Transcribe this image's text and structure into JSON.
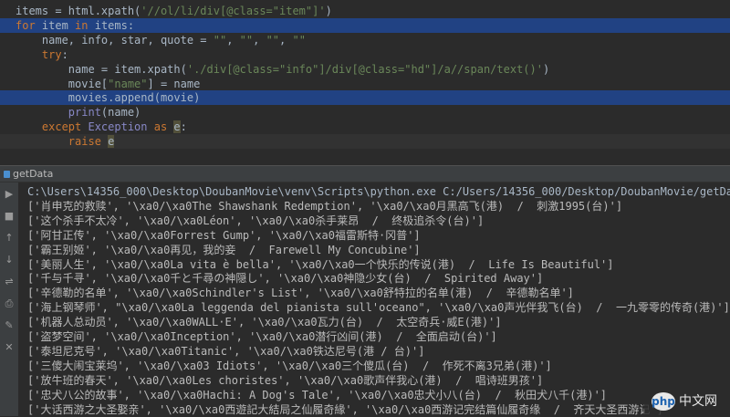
{
  "editor": {
    "lines": [
      {
        "parts": [
          [
            "items = html.xpath(",
            ""
          ],
          [
            "'//ol/li/div[@class=\"item\"]'",
            "str"
          ],
          [
            ")",
            ""
          ]
        ],
        "highlight": false
      },
      {
        "parts": [
          [
            "for ",
            "kw"
          ],
          [
            "item ",
            ""
          ],
          [
            "in ",
            "kw"
          ],
          [
            "items:",
            ""
          ]
        ],
        "highlight": true
      },
      {
        "parts": [
          [
            "    name, info, star, quote = ",
            ""
          ],
          [
            "\"\"",
            "str"
          ],
          [
            ", ",
            ""
          ],
          [
            "\"\"",
            "str"
          ],
          [
            ", ",
            ""
          ],
          [
            "\"\"",
            "str"
          ],
          [
            ", ",
            ""
          ],
          [
            "\"\"",
            "str"
          ]
        ],
        "highlight": false
      },
      {
        "parts": [
          [
            "    ",
            ""
          ],
          [
            "try",
            "kw"
          ],
          [
            ":",
            ""
          ]
        ],
        "highlight": false
      },
      {
        "parts": [
          [
            "        name = item.xpath(",
            ""
          ],
          [
            "'./div[@class=\"info\"]/div[@class=\"hd\"]/a//span/text()'",
            "str"
          ],
          [
            ")",
            ""
          ]
        ],
        "highlight": false
      },
      {
        "parts": [
          [
            "        movie[",
            ""
          ],
          [
            "\"name\"",
            "str"
          ],
          [
            "] = name",
            ""
          ]
        ],
        "highlight": false
      },
      {
        "parts": [
          [
            "        movies.append(movie)",
            ""
          ]
        ],
        "highlight": true
      },
      {
        "parts": [
          [
            "        ",
            ""
          ],
          [
            "print",
            "fn"
          ],
          [
            "(name)",
            ""
          ]
        ],
        "highlight": false
      },
      {
        "parts": [
          [
            "    ",
            ""
          ],
          [
            "except ",
            "kw"
          ],
          [
            "Exception ",
            "cls"
          ],
          [
            "as ",
            "kw"
          ],
          [
            "e",
            "sel"
          ],
          [
            ":",
            ""
          ]
        ],
        "highlight": false
      },
      {
        "parts": [
          [
            "        ",
            ""
          ],
          [
            "raise ",
            "kw"
          ],
          [
            "e",
            "sel"
          ]
        ],
        "highlight": false,
        "caret": true
      }
    ]
  },
  "run_panel": {
    "tab_label": "getData",
    "settings_icon": "gear-icon",
    "hide_icon": "minimize-icon"
  },
  "console": {
    "lines": [
      "C:\\Users\\14356_000\\Desktop\\DoubanMovie\\venv\\Scripts\\python.exe C:/Users/14356_000/Desktop/DoubanMovie/getData.py",
      "['肖申克的救赎', '\\xa0/\\xa0The Shawshank Redemption', '\\xa0/\\xa0月黑高飞(港)  /  刺激1995(台)']",
      "['这个杀手不太冷', '\\xa0/\\xa0Léon', '\\xa0/\\xa0杀手莱昂  /  终极追杀令(台)']",
      "['阿甘正传', '\\xa0/\\xa0Forrest Gump', '\\xa0/\\xa0福雷斯特·冈普']",
      "['霸王别姬', '\\xa0/\\xa0再见，我的妾  /  Farewell My Concubine']",
      "['美丽人生', '\\xa0/\\xa0La vita è bella', '\\xa0/\\xa0一个快乐的传说(港)  /  Life Is Beautiful']",
      "['千与千寻', '\\xa0/\\xa0千と千尋の神隠し', '\\xa0/\\xa0神隐少女(台)  /  Spirited Away']",
      "['辛德勒的名单', '\\xa0/\\xa0Schindler's List', '\\xa0/\\xa0舒特拉的名单(港)  /  辛德勒名单']",
      "['海上钢琴师', \"\\xa0/\\xa0La leggenda del pianista sull'oceano\", '\\xa0/\\xa0声光伴我飞(台)  /  一九零零的传奇(港)']",
      "['机器人总动员', '\\xa0/\\xa0WALL·E', '\\xa0/\\xa0瓦力(台)  /  太空奇兵·威E(港)']",
      "['盗梦空间', '\\xa0/\\xa0Inception', '\\xa0/\\xa0潜行凶间(港)  /  全面启动(台)']",
      "['泰坦尼克号', '\\xa0/\\xa0Titanic', '\\xa0/\\xa0铁达尼号(港 / 台)']",
      "['三傻大闹宝莱坞', '\\xa0/\\xa03 Idiots', '\\xa0/\\xa0三个傻瓜(台)  /  作死不离3兄弟(港)']",
      "['放牛班的春天', '\\xa0/\\xa0Les choristes', '\\xa0/\\xa0歌声伴我心(港)  /  唱诗班男孩']",
      "['忠犬八公的故事', '\\xa0/\\xa0Hachi: A Dog's Tale', '\\xa0/\\xa0忠犬小八(台)  /  秋田犬八千(港)']",
      "['大话西游之大圣娶亲', '\\xa0/\\xa0西遊記大結局之仙履奇緣', '\\xa0/\\xa0西游记完结篇仙履奇缘  /  齐天大圣西游记']"
    ]
  },
  "sidebar_buttons": [
    {
      "icon": "rerun-icon",
      "glyph": "▶"
    },
    {
      "icon": "stop-icon",
      "glyph": "■"
    },
    {
      "icon": "scroll-up-icon",
      "glyph": "↑"
    },
    {
      "icon": "scroll-down-icon",
      "glyph": "↓"
    },
    {
      "icon": "soft-wrap-icon",
      "glyph": "⇌"
    },
    {
      "icon": "print-icon",
      "glyph": "⎙"
    },
    {
      "icon": "pin-icon",
      "glyph": "✎"
    },
    {
      "icon": "trash-icon",
      "glyph": "✕"
    }
  ],
  "watermark": {
    "mark": "php",
    "text": "中文网"
  }
}
